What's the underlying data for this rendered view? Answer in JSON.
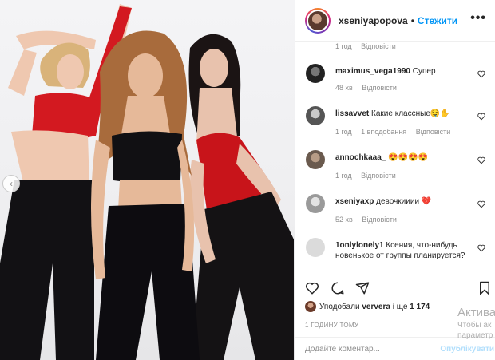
{
  "post": {
    "username": "xseniyapopova",
    "separator": "•",
    "follow_label": "Стежити",
    "more_icon": "more-horizontal-icon"
  },
  "caption_meta": {
    "time": "1 год",
    "reply": "Відповісти"
  },
  "comments": [
    {
      "user": "maximus_vega1990",
      "text": "Супер",
      "time": "48 хв",
      "likes": "",
      "reply": "Відповісти"
    },
    {
      "user": "lissavvet",
      "text": "Какие классные🤤✋",
      "time": "1 год",
      "likes": "1 вподобання",
      "reply": "Відповісти"
    },
    {
      "user": "annochkaaa_",
      "text": "😍😍😍😍",
      "time": "1 год",
      "likes": "",
      "reply": "Відповісти"
    },
    {
      "user": "xseniyaxp",
      "text": "девочкииии 💔",
      "time": "52 хв",
      "likes": "",
      "reply": "Відповісти"
    },
    {
      "user": "1onlylonely1",
      "text": "Ксения, что-нибудь новенькое от группы планируется?",
      "time": "",
      "likes": "",
      "reply": ""
    }
  ],
  "likes": {
    "prefix": "Уподобали",
    "user": "ververa",
    "connector": "і ще",
    "count": "1 174"
  },
  "timestamp": "1 ГОДИНУ ТОМУ",
  "add_comment": {
    "placeholder": "Додайте коментар...",
    "publish_label": "Опублікувати"
  },
  "watermark": {
    "line1": "Актива",
    "line2": "Чтобы ак",
    "line3": "параметр"
  },
  "colors": {
    "accent": "#0095f6",
    "publish_disabled": "#b2dffc",
    "muted": "#8e8e8e",
    "text": "#262626"
  }
}
